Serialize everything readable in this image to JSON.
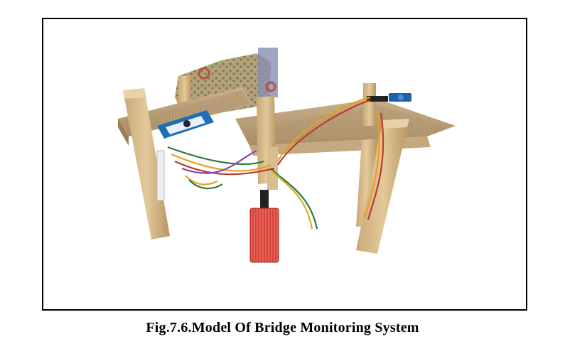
{
  "figure": {
    "caption": "Fig.7.6.Model Of Bridge Monitoring System",
    "photo_subject": "bridge-model-photo"
  }
}
